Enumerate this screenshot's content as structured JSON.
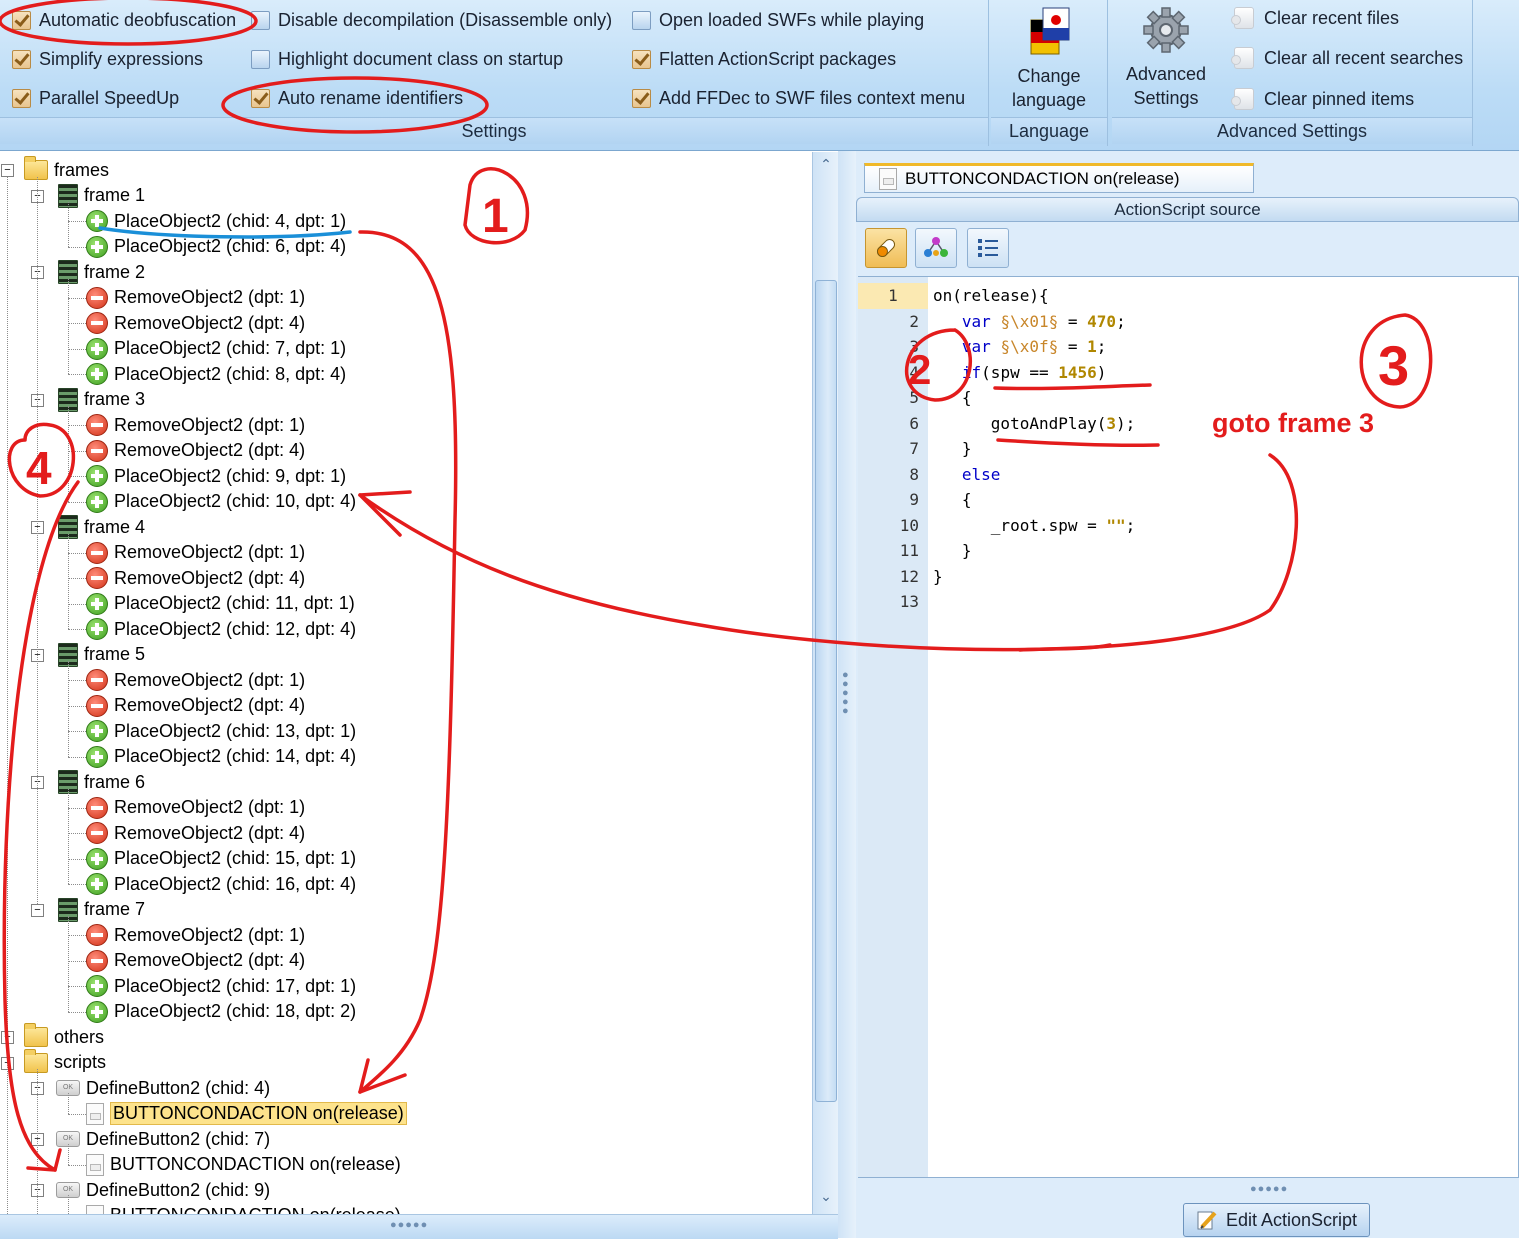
{
  "ribbon": {
    "settings": {
      "label": "Settings",
      "options": [
        {
          "label": "Automatic deobfuscation",
          "checked": true
        },
        {
          "label": "Simplify expressions",
          "checked": true
        },
        {
          "label": "Parallel SpeedUp",
          "checked": true
        },
        {
          "label": "Disable decompilation (Disassemble only)",
          "checked": false
        },
        {
          "label": "Highlight document class on startup",
          "checked": false
        },
        {
          "label": "Auto rename identifiers",
          "checked": true
        },
        {
          "label": "Open loaded SWFs while playing",
          "checked": false
        },
        {
          "label": "Flatten ActionScript packages",
          "checked": true
        },
        {
          "label": "Add FFDec to SWF files context menu",
          "checked": true
        }
      ]
    },
    "language": {
      "label": "Language",
      "button_line1": "Change",
      "button_line2": "language",
      "icon": "flag-icon"
    },
    "advanced": {
      "label": "Advanced Settings",
      "button_line1": "Advanced",
      "button_line2": "Settings",
      "icon": "gear-icon",
      "items": [
        "Clear recent files",
        "Clear all recent searches",
        "Clear pinned items"
      ]
    }
  },
  "tree": {
    "frames_label": "frames",
    "frames": [
      {
        "label": "frame 1",
        "children": [
          {
            "type": "place",
            "label": "PlaceObject2 (chid: 4, dpt: 1)"
          },
          {
            "type": "place",
            "label": "PlaceObject2 (chid: 6, dpt: 4)"
          }
        ]
      },
      {
        "label": "frame 2",
        "children": [
          {
            "type": "remove",
            "label": "RemoveObject2 (dpt: 1)"
          },
          {
            "type": "remove",
            "label": "RemoveObject2 (dpt: 4)"
          },
          {
            "type": "place",
            "label": "PlaceObject2 (chid: 7, dpt: 1)"
          },
          {
            "type": "place",
            "label": "PlaceObject2 (chid: 8, dpt: 4)"
          }
        ]
      },
      {
        "label": "frame 3",
        "children": [
          {
            "type": "remove",
            "label": "RemoveObject2 (dpt: 1)"
          },
          {
            "type": "remove",
            "label": "RemoveObject2 (dpt: 4)"
          },
          {
            "type": "place",
            "label": "PlaceObject2 (chid: 9, dpt: 1)"
          },
          {
            "type": "place",
            "label": "PlaceObject2 (chid: 10, dpt: 4)"
          }
        ]
      },
      {
        "label": "frame 4",
        "children": [
          {
            "type": "remove",
            "label": "RemoveObject2 (dpt: 1)"
          },
          {
            "type": "remove",
            "label": "RemoveObject2 (dpt: 4)"
          },
          {
            "type": "place",
            "label": "PlaceObject2 (chid: 11, dpt: 1)"
          },
          {
            "type": "place",
            "label": "PlaceObject2 (chid: 12, dpt: 4)"
          }
        ]
      },
      {
        "label": "frame 5",
        "children": [
          {
            "type": "remove",
            "label": "RemoveObject2 (dpt: 1)"
          },
          {
            "type": "remove",
            "label": "RemoveObject2 (dpt: 4)"
          },
          {
            "type": "place",
            "label": "PlaceObject2 (chid: 13, dpt: 1)"
          },
          {
            "type": "place",
            "label": "PlaceObject2 (chid: 14, dpt: 4)"
          }
        ]
      },
      {
        "label": "frame 6",
        "children": [
          {
            "type": "remove",
            "label": "RemoveObject2 (dpt: 1)"
          },
          {
            "type": "remove",
            "label": "RemoveObject2 (dpt: 4)"
          },
          {
            "type": "place",
            "label": "PlaceObject2 (chid: 15, dpt: 1)"
          },
          {
            "type": "place",
            "label": "PlaceObject2 (chid: 16, dpt: 4)"
          }
        ]
      },
      {
        "label": "frame 7",
        "children": [
          {
            "type": "remove",
            "label": "RemoveObject2 (dpt: 1)"
          },
          {
            "type": "remove",
            "label": "RemoveObject2 (dpt: 4)"
          },
          {
            "type": "place",
            "label": "PlaceObject2 (chid: 17, dpt: 1)"
          },
          {
            "type": "place",
            "label": "PlaceObject2 (chid: 18, dpt: 2)"
          }
        ]
      }
    ],
    "others_label": "others",
    "scripts_label": "scripts",
    "scripts": [
      {
        "label": "DefineButton2 (chid: 4)",
        "child": "BUTTONCONDACTION on(release)",
        "selected": true
      },
      {
        "label": "DefineButton2 (chid: 7)",
        "child": "BUTTONCONDACTION on(release)",
        "selected": false
      },
      {
        "label": "DefineButton2 (chid: 9)",
        "child": "BUTTONCONDACTION on(release)",
        "selected": false
      }
    ]
  },
  "editor": {
    "tab_label": "BUTTONCONDACTION on(release)",
    "title": "ActionScript source",
    "current_line": 1,
    "line_count": 13,
    "code": [
      [
        [
          "t",
          "on(release){"
        ]
      ],
      [
        [
          "t",
          "   "
        ],
        [
          "k",
          "var"
        ],
        [
          "t",
          " "
        ],
        [
          "i",
          "§\\x01§"
        ],
        [
          "t",
          " = "
        ],
        [
          "n",
          "470"
        ],
        [
          "t",
          ";"
        ]
      ],
      [
        [
          "t",
          "   "
        ],
        [
          "k",
          "var"
        ],
        [
          "t",
          " "
        ],
        [
          "i",
          "§\\x0f§"
        ],
        [
          "t",
          " = "
        ],
        [
          "n",
          "1"
        ],
        [
          "t",
          ";"
        ]
      ],
      [
        [
          "t",
          "   "
        ],
        [
          "k",
          "if"
        ],
        [
          "t",
          "(spw == "
        ],
        [
          "n",
          "1456"
        ],
        [
          "t",
          ")"
        ]
      ],
      [
        [
          "t",
          "   {"
        ]
      ],
      [
        [
          "t",
          "      gotoAndPlay("
        ],
        [
          "n",
          "3"
        ],
        [
          "t",
          ");"
        ]
      ],
      [
        [
          "t",
          "   }"
        ]
      ],
      [
        [
          "t",
          "   "
        ],
        [
          "k",
          "else"
        ]
      ],
      [
        [
          "t",
          "   {"
        ]
      ],
      [
        [
          "t",
          "      _root.spw = "
        ],
        [
          "s",
          "\"\""
        ],
        [
          "t",
          ";"
        ]
      ],
      [
        [
          "t",
          "   }"
        ]
      ],
      [
        [
          "t",
          "}"
        ]
      ],
      [
        [
          "t",
          ""
        ]
      ]
    ],
    "edit_button": "Edit ActionScript"
  },
  "annotations": {
    "color": "#e31c1c",
    "numbers": [
      "1",
      "2",
      "3",
      "4"
    ],
    "note": "goto frame 3"
  }
}
